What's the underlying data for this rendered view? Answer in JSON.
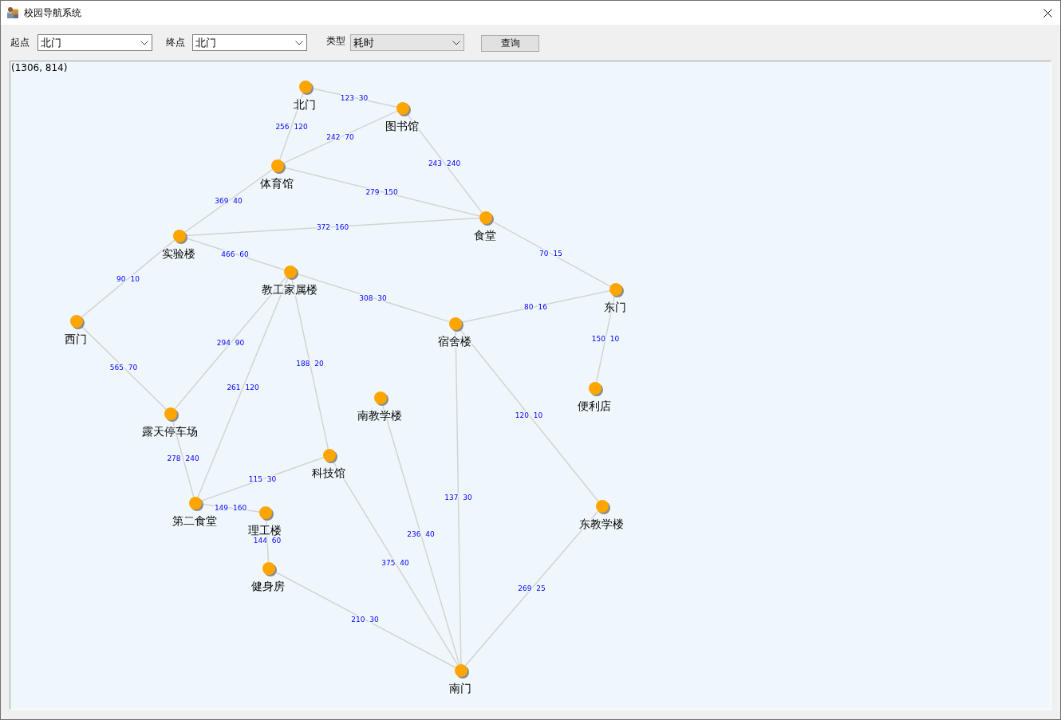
{
  "window": {
    "title": "校园导航系统"
  },
  "toolbar": {
    "fields": [
      {
        "label": "起点",
        "kind": "combo",
        "value": "北门"
      },
      {
        "label": "终点",
        "kind": "combo",
        "value": "北门"
      },
      {
        "label": "类型",
        "kind": "list",
        "value": "耗时"
      }
    ],
    "button": "查询"
  },
  "map": {
    "readout": "(1306, 814)",
    "places": [
      {
        "name": "北门"
      },
      {
        "name": "图书馆"
      },
      {
        "name": "体育馆"
      },
      {
        "name": "食堂"
      },
      {
        "name": "实验楼"
      },
      {
        "name": "教工家属楼"
      },
      {
        "name": "东门"
      },
      {
        "name": "西门"
      },
      {
        "name": "宿舍楼"
      },
      {
        "name": "便利店"
      },
      {
        "name": "南教学楼"
      },
      {
        "name": "露天停车场"
      },
      {
        "name": "科技馆"
      },
      {
        "name": "第二食堂"
      },
      {
        "name": "东教学楼"
      },
      {
        "name": "理工楼"
      },
      {
        "name": "健身房"
      },
      {
        "name": "南门"
      }
    ],
    "roads": [
      {
        "label": "123 30"
      },
      {
        "label": "256 120"
      },
      {
        "label": "242 70"
      },
      {
        "label": "243 240"
      },
      {
        "label": "279 150"
      },
      {
        "label": "369 40"
      },
      {
        "label": "372 160"
      },
      {
        "label": "466 60"
      },
      {
        "label": "70 15"
      },
      {
        "label": "90 10"
      },
      {
        "label": "308 30"
      },
      {
        "label": "80 16"
      },
      {
        "label": "150 10"
      },
      {
        "label": "294 90"
      },
      {
        "label": "188 20"
      },
      {
        "label": "565 70"
      },
      {
        "label": "261 120"
      },
      {
        "label": "120 10"
      },
      {
        "label": "278 240"
      },
      {
        "label": "115 30"
      },
      {
        "label": "137 30"
      },
      {
        "label": "149 160"
      },
      {
        "label": "236 40"
      },
      {
        "label": "144 60"
      },
      {
        "label": "375 40"
      },
      {
        "label": "269 25"
      },
      {
        "label": "210 30"
      }
    ]
  }
}
